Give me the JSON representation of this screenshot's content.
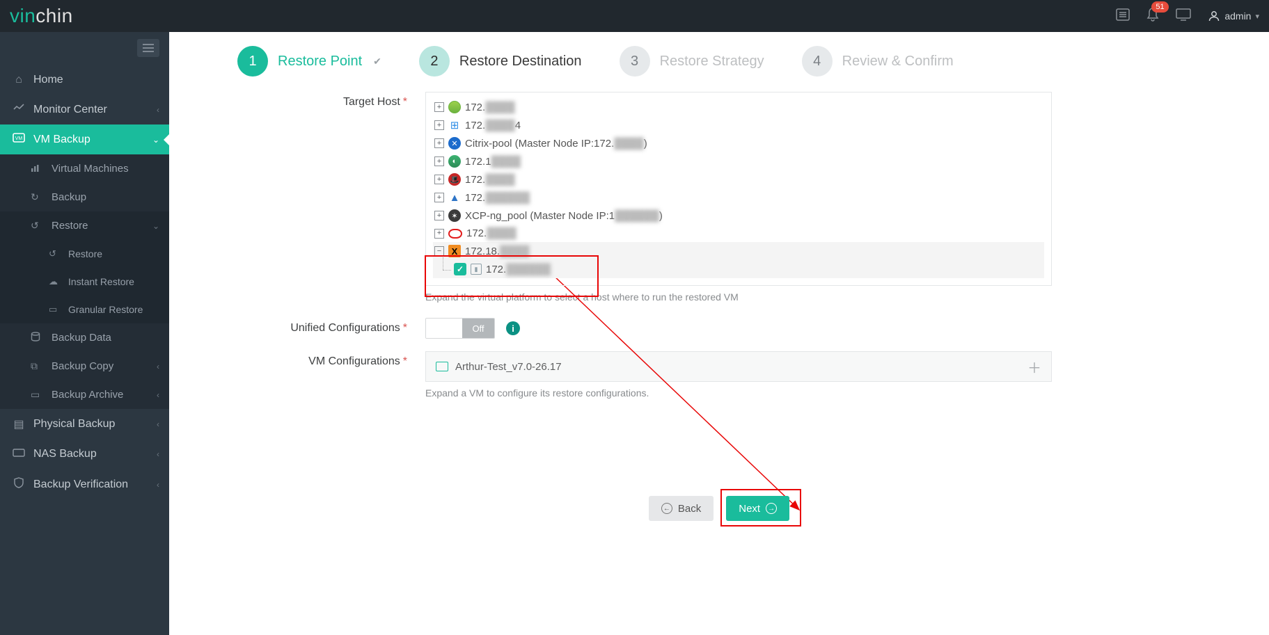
{
  "topbar": {
    "logo_vin": "vin",
    "logo_chin": "chin",
    "notifications_count": "51",
    "username": "admin"
  },
  "sidebar": {
    "home": "Home",
    "monitor_center": "Monitor Center",
    "vm_backup": "VM Backup",
    "virtual_machines": "Virtual Machines",
    "backup": "Backup",
    "restore": "Restore",
    "restore_sub": "Restore",
    "instant_restore": "Instant Restore",
    "granular_restore": "Granular Restore",
    "backup_data": "Backup Data",
    "backup_copy": "Backup Copy",
    "backup_archive": "Backup Archive",
    "physical_backup": "Physical Backup",
    "nas_backup": "NAS Backup",
    "backup_verification": "Backup Verification"
  },
  "wizard": {
    "step1_num": "1",
    "step1_label": "Restore Point",
    "step2_num": "2",
    "step2_label": "Restore Destination",
    "step3_num": "3",
    "step3_label": "Restore Strategy",
    "step4_num": "4",
    "step4_label": "Review & Confirm"
  },
  "form": {
    "target_host_label": "Target Host",
    "tree": [
      {
        "text_prefix": "172.",
        "blurred_tail": "",
        "icon": "vmware"
      },
      {
        "text_prefix": "172.",
        "blurred_tail": "4",
        "icon": "windows"
      },
      {
        "text_prefix": "Citrix-pool (Master Node IP:172.",
        "blurred_tail": ")",
        "icon": "citrix"
      },
      {
        "text_prefix": "172.1",
        "blurred_tail": "",
        "icon": "openstack"
      },
      {
        "text_prefix": "172.",
        "blurred_tail": "",
        "icon": "redhat"
      },
      {
        "text_prefix": "172.",
        "blurred_tail": "",
        "icon": "azure"
      },
      {
        "text_prefix": "XCP-ng_pool (Master Node IP:1",
        "blurred_tail": ")",
        "icon": "xcp"
      },
      {
        "text_prefix": "172.",
        "blurred_tail": "",
        "icon": "oracle"
      }
    ],
    "expanded_host_prefix": "172.18.",
    "expanded_child_prefix": "172.",
    "target_host_hint": "Expand the virtual platform to select a host where to run the restored VM",
    "unified_label": "Unified Configurations",
    "unified_state": "Off",
    "vm_config_label": "VM Configurations",
    "vm_config_name": "Arthur-Test_v7.0-26.17",
    "vm_config_hint": "Expand a VM to configure its restore configurations."
  },
  "footer": {
    "back": "Back",
    "next": "Next"
  }
}
